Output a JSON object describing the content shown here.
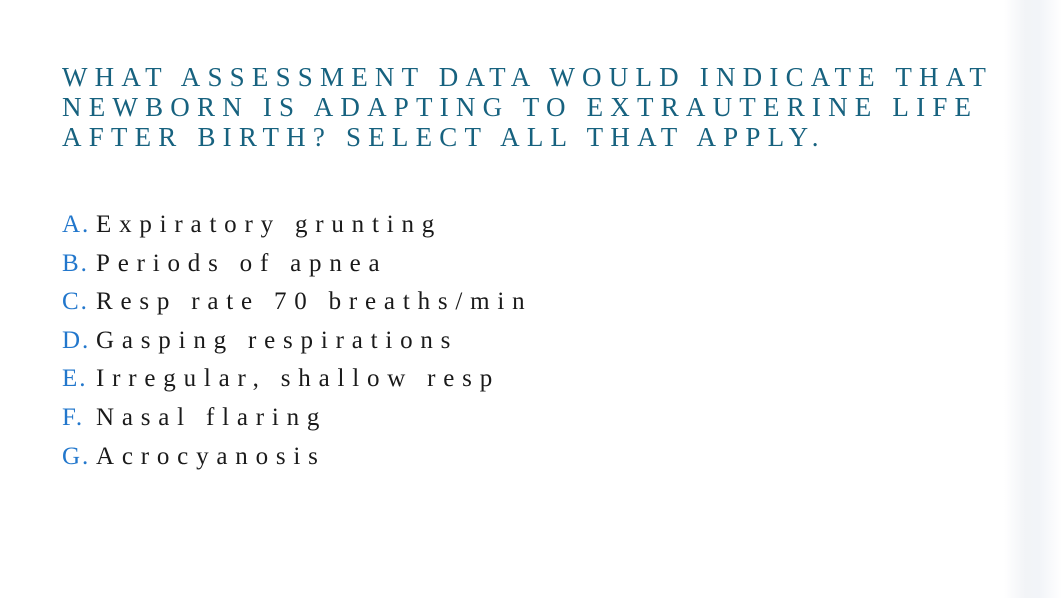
{
  "slide": {
    "background_color": "#ffffff",
    "title_color": "#17627f",
    "marker_color": "#2277cc",
    "body_color": "#1a1a1a"
  },
  "question": {
    "full_text": "WHAT ASSESSMENT DATA WOULD INDICATE THAT NEWBORN IS ADAPTING TO EXTRAUTERINE LIFE AFTER BIRTH? SELECT ALL THAT APPLY.",
    "lines": [
      "WHAT ASSESSMENT DATA WOULD INDICATE THAT",
      "NEWBORN IS ADAPTING TO EXTRAUTERINE LIFE",
      "AFTER BIRTH? SELECT ALL THAT APPLY."
    ]
  },
  "options": [
    {
      "marker": "A.",
      "text": "Expiratory grunting"
    },
    {
      "marker": "B.",
      "text": "Periods of apnea"
    },
    {
      "marker": "C.",
      "text": "Resp rate 70 breaths/min"
    },
    {
      "marker": "D.",
      "text": "Gasping respirations"
    },
    {
      "marker": "E.",
      "text": "Irregular, shallow resp"
    },
    {
      "marker": "F.",
      "text": "Nasal flaring"
    },
    {
      "marker": "G.",
      "text": "Acrocyanosis"
    }
  ]
}
